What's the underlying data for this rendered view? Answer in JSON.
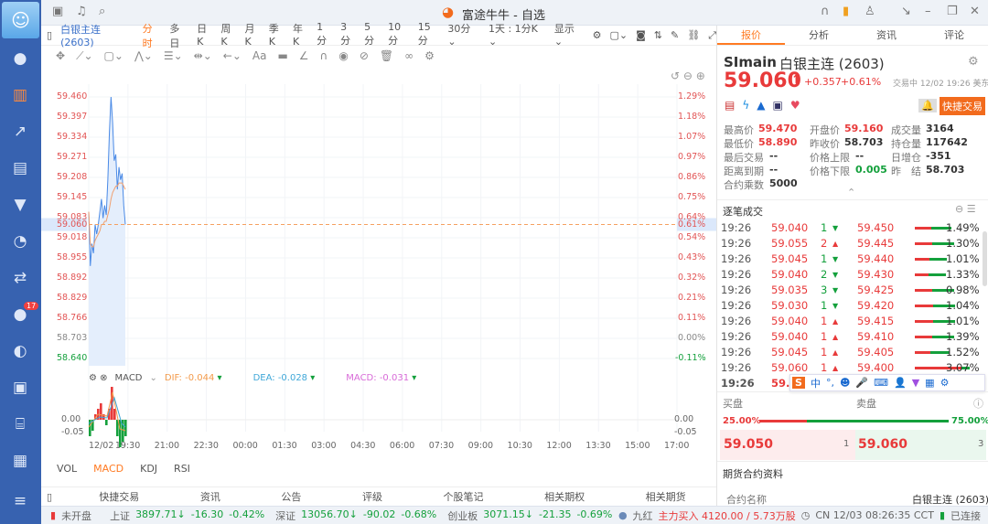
{
  "app": {
    "title": "富途牛牛 - 自选",
    "logo": "moomoo-logo"
  },
  "sidebar": {
    "badge": "17",
    "icons": [
      "user-icon",
      "chart-bar-icon",
      "trend-icon",
      "market-icon",
      "filter-icon",
      "pie-icon",
      "exchange-icon",
      "chat-icon",
      "drop-icon",
      "game-icon",
      "code-icon",
      "news-icon",
      "menu-icon"
    ]
  },
  "toolbar": {
    "symbol": "白银主连 (2603)",
    "periods": [
      "分时",
      "多日",
      "日K",
      "周K",
      "月K",
      "季K",
      "年K",
      "1分",
      "3分",
      "5分",
      "10分",
      "15分",
      "30分 ⌄",
      "1天 : 1分K ⌄",
      "显示 ⌄"
    ],
    "active": "分时"
  },
  "chart": {
    "price_labels": [
      "59.460",
      "59.397",
      "59.334",
      "59.271",
      "59.208",
      "59.145",
      "59.083",
      "59.018",
      "58.955",
      "58.892",
      "58.829",
      "58.766",
      "58.703",
      "58.640"
    ],
    "pct_labels": [
      "1.29%",
      "1.18%",
      "1.07%",
      "0.97%",
      "0.86%",
      "0.75%",
      "0.64%",
      "0.54%",
      "0.43%",
      "0.32%",
      "0.21%",
      "0.11%",
      "0.00%",
      "-0.11%"
    ],
    "current_price": "59.060",
    "current_pct": "0.61%",
    "macd": {
      "name": "MACD",
      "dif_label": "DIF:",
      "dif": "-0.044",
      "dea_label": "DEA:",
      "dea": "-0.028",
      "macd_label": "MACD:",
      "macd": "-0.031",
      "axis": [
        "0.00",
        "-0.05"
      ]
    },
    "time_labels": [
      "12/02",
      "19:30",
      "21:00",
      "22:30",
      "00:00",
      "01:30",
      "03:00",
      "04:30",
      "06:00",
      "07:30",
      "09:00",
      "10:30",
      "12:00",
      "13:30",
      "15:00",
      "17:00"
    ],
    "indicator_tabs": [
      "VOL",
      "MACD",
      "KDJ",
      "RSI"
    ],
    "active_indicator": "MACD"
  },
  "chart_data": {
    "type": "line",
    "title": "白银主连 分时",
    "ylim": [
      58.64,
      59.46
    ],
    "prev_close": 58.703,
    "price": [
      59.1,
      58.93,
      59.0,
      58.97,
      59.06,
      59.03,
      59.06,
      59.1,
      59.14,
      59.08,
      59.12,
      59.09,
      59.2,
      59.35,
      59.46,
      59.38,
      59.26,
      59.28,
      59.17,
      59.24,
      59.2,
      59.22,
      59.12,
      59.06
    ],
    "avg": [
      59.1,
      59.0,
      58.99,
      58.99,
      59.01,
      59.02,
      59.03,
      59.04,
      59.06,
      59.06,
      59.07,
      59.07,
      59.09,
      59.11,
      59.14,
      59.16,
      59.17,
      59.18,
      59.18,
      59.19,
      59.19,
      59.19,
      59.18,
      59.17
    ],
    "macd_hist": [
      -0.03,
      -0.02,
      0.01,
      0.02,
      0.03,
      0.01,
      -0.01,
      0.02,
      0.06,
      0.02,
      -0.03,
      -0.05,
      -0.04,
      -0.03
    ]
  },
  "bottom_tabs": [
    "快捷交易",
    "资讯",
    "公告",
    "评级",
    "个股笔记",
    "相关期权",
    "相关期货"
  ],
  "status": {
    "market_state": "未开盘",
    "indices": [
      {
        "name": "上证",
        "value": "3897.71↓",
        "chg": "-16.30",
        "pct": "-0.42%"
      },
      {
        "name": "深证",
        "value": "13056.70↓",
        "chg": "-90.02",
        "pct": "-0.68%"
      },
      {
        "name": "创业板",
        "value": "3071.15↓",
        "chg": "-21.35",
        "pct": "-0.69%"
      }
    ],
    "ticker_name": "九红",
    "flow": "主力买入 4120.00 / 5.73万股",
    "clock": "CN 12/03 08:26:35 CCT",
    "conn": "已连接"
  },
  "right": {
    "tabs": [
      "报价",
      "分析",
      "资讯",
      "评论"
    ],
    "code": "SImain",
    "name": "白银主连 (2603)",
    "price": "59.060",
    "change": "+0.357",
    "pct": "+0.61%",
    "state": "交易中 12/02 19:26 美东",
    "quick_trade": "快捷交易",
    "stats": [
      [
        {
          "k": "最高价",
          "v": "59.470",
          "c": "r"
        },
        {
          "k": "开盘价",
          "v": "59.160",
          "c": "r"
        },
        {
          "k": "成交量",
          "v": "3164",
          "c": "d"
        }
      ],
      [
        {
          "k": "最低价",
          "v": "58.890",
          "c": "r"
        },
        {
          "k": "昨收价",
          "v": "58.703",
          "c": "d"
        },
        {
          "k": "持仓量",
          "v": "117642",
          "c": "d"
        }
      ],
      [
        {
          "k": "最后交易",
          "v": "--",
          "c": "d"
        },
        {
          "k": "价格上限",
          "v": "--",
          "c": "d"
        },
        {
          "k": "日增仓",
          "v": "-351",
          "c": "d"
        }
      ],
      [
        {
          "k": "距离到期",
          "v": "--",
          "c": "d"
        },
        {
          "k": "价格下限",
          "v": "0.005",
          "c": "g"
        },
        {
          "k": "昨　结",
          "v": "58.703",
          "c": "d"
        }
      ],
      [
        {
          "k": "合约乘数",
          "v": "5000",
          "c": "d"
        }
      ]
    ],
    "ticks_title": "逐笔成交",
    "ticks": [
      {
        "t": "19:26",
        "p": "59.040",
        "q": "1",
        "d": "down",
        "p2": "59.450",
        "pct": "1.49%",
        "frac": 0.45
      },
      {
        "t": "19:26",
        "p": "59.055",
        "q": "2",
        "d": "up",
        "p2": "59.445",
        "pct": "1.30%",
        "frac": 0.55
      },
      {
        "t": "19:26",
        "p": "59.045",
        "q": "1",
        "d": "down",
        "p2": "59.440",
        "pct": "1.01%",
        "frac": 0.3
      },
      {
        "t": "19:26",
        "p": "59.040",
        "q": "2",
        "d": "down",
        "p2": "59.430",
        "pct": "1.33%",
        "frac": 0.25
      },
      {
        "t": "19:26",
        "p": "59.035",
        "q": "3",
        "d": "down",
        "p2": "59.425",
        "pct": "0.98%",
        "frac": 0.55
      },
      {
        "t": "19:26",
        "p": "59.030",
        "q": "1",
        "d": "down",
        "p2": "59.420",
        "pct": "1.04%",
        "frac": 0.6
      },
      {
        "t": "19:26",
        "p": "59.040",
        "q": "1",
        "d": "up",
        "p2": "59.415",
        "pct": "1.01%",
        "frac": 0.6
      },
      {
        "t": "19:26",
        "p": "59.040",
        "q": "1",
        "d": "up",
        "p2": "59.410",
        "pct": "1.39%",
        "frac": 0.55
      },
      {
        "t": "19:26",
        "p": "59.045",
        "q": "1",
        "d": "up",
        "p2": "59.405",
        "pct": "1.52%",
        "frac": 0.4
      },
      {
        "t": "19:26",
        "p": "59.060",
        "q": "1",
        "d": "up",
        "p2": "59.400",
        "pct": "3.07%",
        "frac": 0.8
      },
      {
        "t": "19:26",
        "p": "59.060",
        "q": "",
        "d": "",
        "p2": "",
        "pct": "",
        "frac": 0
      }
    ],
    "bid_label": "买盘",
    "ask_label": "卖盘",
    "bid_pct": "25.00%",
    "ask_pct": "75.00%",
    "bid_frac": 0.25,
    "bid": "59.050",
    "bid_qty": "1",
    "ask": "59.060",
    "ask_qty": "3",
    "info_title": "期货合约资料",
    "contract_label": "合约名称",
    "contract_value": "白银主连 (2603)"
  }
}
